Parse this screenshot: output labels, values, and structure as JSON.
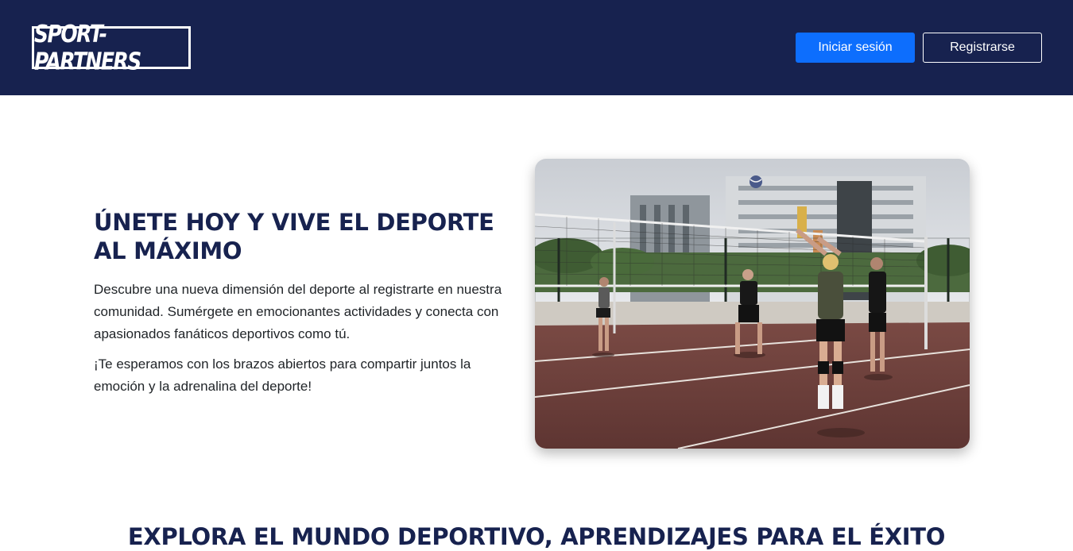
{
  "header": {
    "logo_text": "SPORT-PARTNERS",
    "login_label": "Iniciar sesión",
    "register_label": "Registrarse",
    "background_color": "#17224f",
    "login_button_color": "#0d6efd"
  },
  "hero": {
    "title": "ÚNETE HOY Y VIVE EL DEPORTE AL MÁXIMO",
    "paragraph_1": "Descubre una nueva dimensión del deporte al registrarte en nuestra comunidad. Sumérgete en emocionantes actividades y conecta con apasionados fanáticos deportivos como tú.",
    "paragraph_2": "¡Te esperamos con los brazos abiertos para compartir juntos la emoción y la adrenalina del deporte!",
    "image_subject": "people-playing-volleyball-outdoor-court"
  },
  "explore": {
    "title": "EXPLORA EL MUNDO DEPORTIVO, APRENDIZAJES PARA EL ÉXITO"
  }
}
